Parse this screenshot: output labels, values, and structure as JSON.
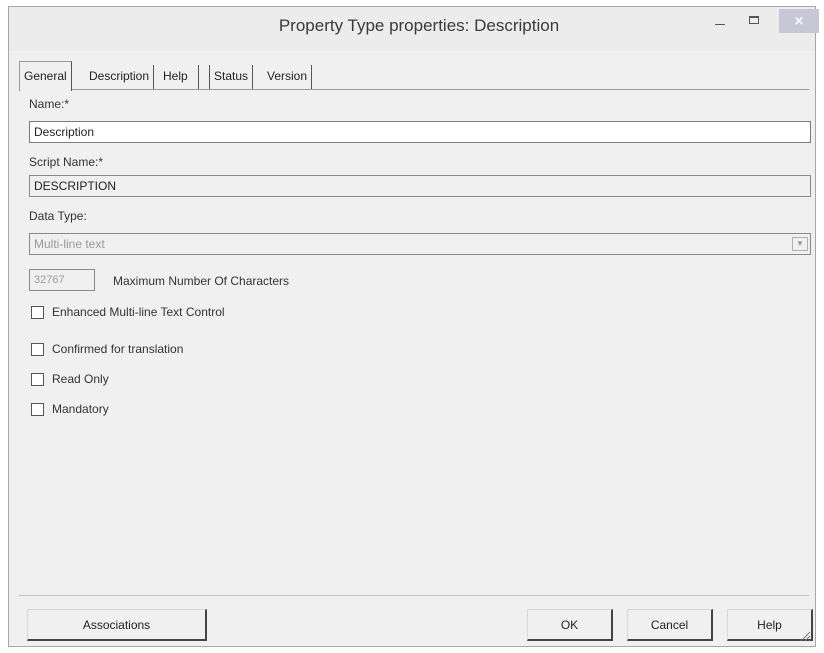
{
  "window": {
    "title": "Property Type properties: Description",
    "close_glyph": "×"
  },
  "tabs": [
    {
      "label": "General",
      "active": true
    },
    {
      "label": "Description",
      "active": false
    },
    {
      "label": "Help",
      "active": false
    },
    {
      "label": "Status",
      "active": false
    },
    {
      "label": "Version",
      "active": false
    }
  ],
  "general": {
    "name_label": "Name:*",
    "name_value": "Description",
    "script_name_label": "Script Name:*",
    "script_name_value": "DESCRIPTION",
    "data_type_label": "Data Type:",
    "data_type_value": "Multi-line text",
    "max_chars_value": "32767",
    "max_chars_label": "Maximum Number Of Characters",
    "checkboxes": [
      {
        "label": "Enhanced Multi-line Text Control",
        "checked": false
      },
      {
        "label": "Confirmed for translation",
        "checked": false
      },
      {
        "label": "Read Only",
        "checked": false
      },
      {
        "label": "Mandatory",
        "checked": false
      }
    ]
  },
  "buttons": {
    "associations": "Associations",
    "ok": "OK",
    "cancel": "Cancel",
    "help": "Help"
  },
  "colors": {
    "window_bg": "#f0f0f0",
    "disabled_text": "#999999",
    "close_button": "#c7c7d6"
  }
}
